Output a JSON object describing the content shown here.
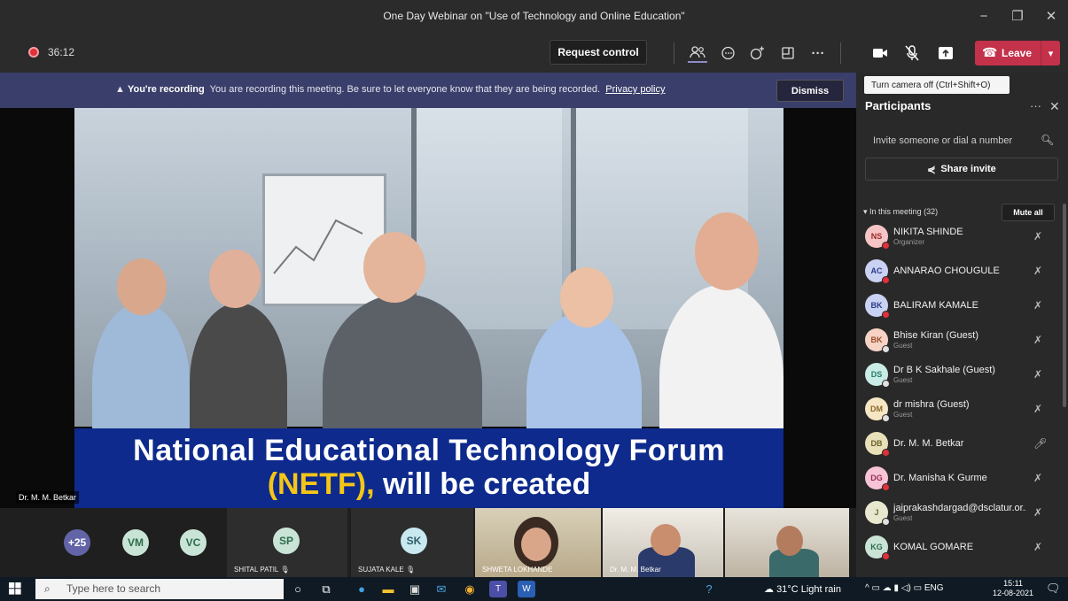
{
  "window": {
    "title": "One Day Webinar on \"Use of Technology and Online Education\"",
    "minimize": "−",
    "maximize": "❐",
    "close": "✕"
  },
  "toolbar": {
    "timer": "36:12",
    "request_control": "Request control",
    "leave_label": "Leave",
    "icons": [
      "people-icon",
      "chat-icon",
      "reactions-icon",
      "rooms-icon",
      "more-icon",
      "camera-icon",
      "mic-off-icon",
      "share-icon"
    ]
  },
  "notice": {
    "bold": "You're recording",
    "text": "You are recording this meeting. Be sure to let everyone know that they are being recorded.",
    "link": "Privacy policy",
    "dismiss": "Dismiss"
  },
  "tooltip": "Turn camera off (Ctrl+Shift+O)",
  "video": {
    "caption_line1": "National Educational Technology Forum",
    "caption_line2_highlight": "(NETF),",
    "caption_line2_rest": " will be created",
    "speaker_name": "Dr. M. M. Betkar"
  },
  "gallery": {
    "overflow": "+25",
    "avatars": [
      {
        "initials": "VM",
        "color": "#c9e4d6",
        "text": "#2e6b4a"
      },
      {
        "initials": "VC",
        "color": "#c9e4d6",
        "text": "#2e6b4a"
      }
    ],
    "tiles": [
      {
        "initials": "SP",
        "name": "SHITAL PATIL",
        "color": "#c9e4d6",
        "text": "#2e6b4a"
      },
      {
        "initials": "SK",
        "name": "SUJATA KALE",
        "color": "#c9e9f0",
        "text": "#2e5f6b"
      }
    ],
    "cams": [
      "SHWETA LOKHANDE",
      "Dr. M. M. Betkar",
      ""
    ]
  },
  "participants": {
    "title": "Participants",
    "more": "···",
    "close": "✕",
    "invite_placeholder": "Invite someone or dial a number",
    "share_invite": "Share invite",
    "in_meeting": "In this meeting (32)",
    "mute_all": "Mute all",
    "list": [
      {
        "initials": "NS",
        "name": "NIKITA SHINDE",
        "sub": "Organizer",
        "color": "#f6c4c4",
        "text": "#9a2b2b",
        "status": "#e0303a"
      },
      {
        "initials": "AC",
        "name": "ANNARAO CHOUGULE",
        "sub": "",
        "color": "#c9d2f2",
        "text": "#2b3d8a",
        "status": "#e0303a"
      },
      {
        "initials": "BK",
        "name": "BALIRAM KAMALE",
        "sub": "",
        "color": "#c9d2f2",
        "text": "#2b3d8a",
        "status": "#e0303a"
      },
      {
        "initials": "BK",
        "name": "Bhise Kiran (Guest)",
        "sub": "Guest",
        "color": "#f6d3c4",
        "text": "#9a4b2b",
        "status": "#e0e0e0"
      },
      {
        "initials": "DS",
        "name": "Dr B K Sakhale (Guest)",
        "sub": "Guest",
        "color": "#c9ece6",
        "text": "#2b7a6b",
        "status": "#e0e0e0"
      },
      {
        "initials": "DM",
        "name": "dr mishra (Guest)",
        "sub": "Guest",
        "color": "#f6e6c4",
        "text": "#8a6a2b",
        "status": "#e0e0e0"
      },
      {
        "initials": "DB",
        "name": "Dr. M. M. Betkar",
        "sub": "",
        "color": "#e8e0b8",
        "text": "#6b5e2b",
        "status": "#e0303a"
      },
      {
        "initials": "DG",
        "name": "Dr. Manisha K Gurme",
        "sub": "",
        "color": "#f6c4d6",
        "text": "#9a2b52",
        "status": "#e0303a"
      },
      {
        "initials": "J",
        "name": "jaiprakashdargad@dsclatur.or...",
        "sub": "Guest",
        "color": "#e8e8d0",
        "text": "#6b6b3a",
        "status": "#e0e0e0"
      },
      {
        "initials": "KG",
        "name": "KOMAL GOMARE",
        "sub": "",
        "color": "#c9e4d6",
        "text": "#2e6b4a",
        "status": "#e0303a"
      }
    ]
  },
  "taskbar": {
    "search_placeholder": "Type here to search",
    "weather": "31°C  Light rain",
    "lang": "ENG",
    "time": "15:11",
    "date": "12-08-2021"
  }
}
